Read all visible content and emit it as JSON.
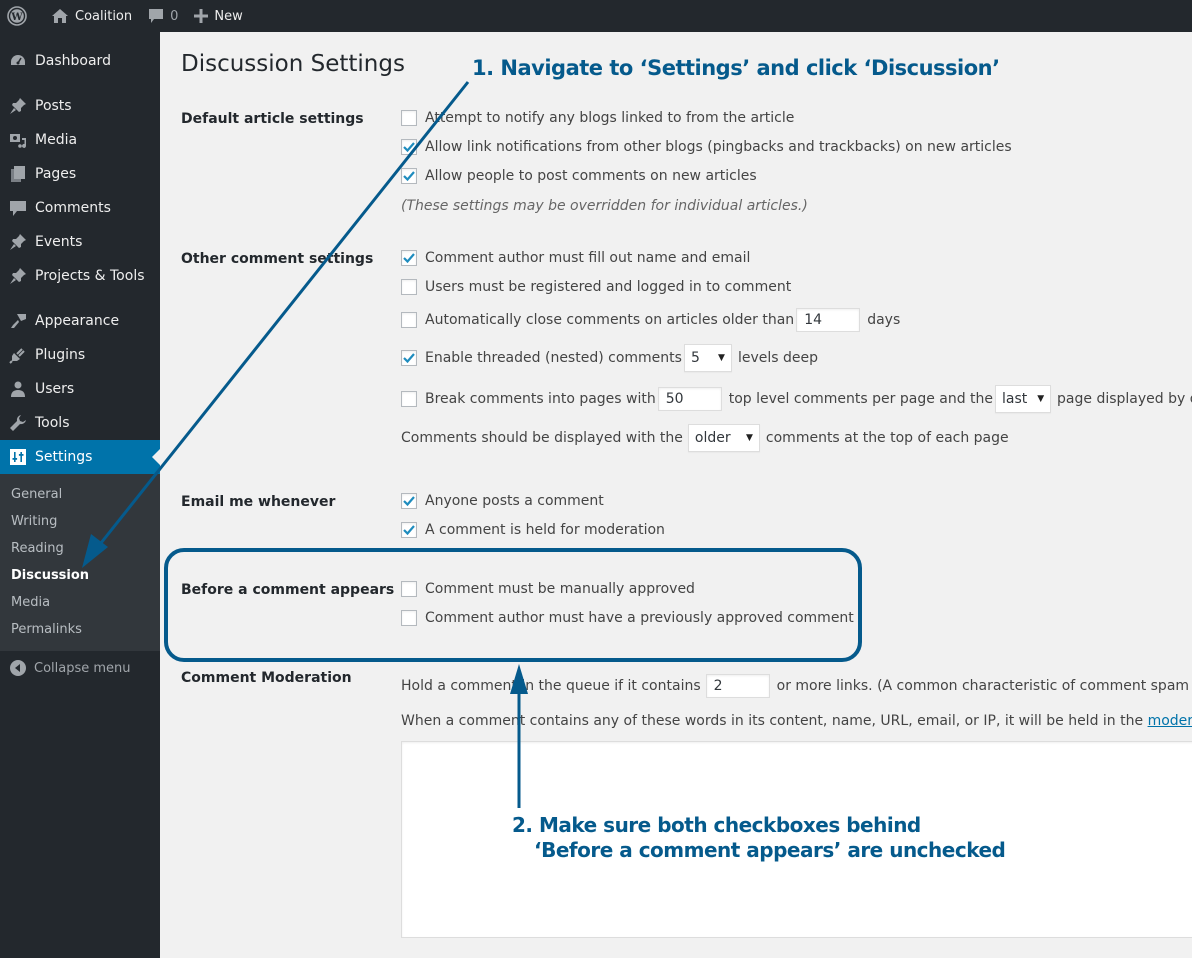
{
  "admin_bar": {
    "site_name": "Coalition",
    "comments_count": "0",
    "new_label": "New",
    "icons": [
      "wordpress-logo-icon",
      "home-icon",
      "comment-bubble-icon",
      "plus-icon"
    ]
  },
  "sidebar": {
    "items": [
      {
        "label": "Dashboard",
        "icon": "dashboard-gauge-icon"
      },
      {
        "label": "Posts",
        "icon": "pushpin-icon"
      },
      {
        "label": "Media",
        "icon": "media-camera-music-icon"
      },
      {
        "label": "Pages",
        "icon": "pages-icon"
      },
      {
        "label": "Comments",
        "icon": "comment-bubble-icon"
      },
      {
        "label": "Events",
        "icon": "pushpin-icon"
      },
      {
        "label": "Projects & Tools",
        "icon": "pushpin-icon"
      },
      {
        "label": "Appearance",
        "icon": "paintbrush-icon"
      },
      {
        "label": "Plugins",
        "icon": "plug-icon"
      },
      {
        "label": "Users",
        "icon": "user-icon"
      },
      {
        "label": "Tools",
        "icon": "wrench-icon"
      },
      {
        "label": "Settings",
        "icon": "sliders-icon",
        "current": true
      }
    ],
    "submenu": [
      {
        "label": "General"
      },
      {
        "label": "Writing"
      },
      {
        "label": "Reading"
      },
      {
        "label": "Discussion",
        "current": true
      },
      {
        "label": "Media"
      },
      {
        "label": "Permalinks"
      }
    ],
    "collapse_label": "Collapse menu"
  },
  "page": {
    "title": "Discussion Settings",
    "sections": {
      "default_article": {
        "label": "Default article settings",
        "options": [
          {
            "label": "Attempt to notify any blogs linked to from the article",
            "checked": false
          },
          {
            "label": "Allow link notifications from other blogs (pingbacks and trackbacks) on new articles",
            "checked": true
          },
          {
            "label": "Allow people to post comments on new articles",
            "checked": true
          }
        ],
        "note": "(These settings may be overridden for individual articles.)"
      },
      "other_comment": {
        "label": "Other comment settings",
        "require_name_email": {
          "label": "Comment author must fill out name and email",
          "checked": true
        },
        "registration": {
          "label": "Users must be registered and logged in to comment",
          "checked": false
        },
        "auto_close": {
          "label_before": "Automatically close comments on articles older than",
          "value": "14",
          "label_after": "days",
          "checked": false
        },
        "threaded": {
          "label_before": "Enable threaded (nested) comments",
          "value": "5",
          "label_after": "levels deep",
          "checked": true
        },
        "paging": {
          "label_before": "Break comments into pages with",
          "per_page": "50",
          "label_middle": "top level comments per page and the",
          "default_page": "last",
          "label_after": "page displayed by default",
          "checked": false
        },
        "order": {
          "label_before": "Comments should be displayed with the",
          "value": "older",
          "label_after": "comments at the top of each page"
        }
      },
      "email": {
        "label": "Email me whenever",
        "options": [
          {
            "label": "Anyone posts a comment",
            "checked": true
          },
          {
            "label": "A comment is held for moderation",
            "checked": true
          }
        ]
      },
      "before_appears": {
        "label": "Before a comment appears",
        "options": [
          {
            "label": "Comment must be manually approved",
            "checked": false
          },
          {
            "label": "Comment author must have a previously approved comment",
            "checked": false
          }
        ]
      },
      "moderation": {
        "label": "Comment Moderation",
        "hold_before": "Hold a comment in the queue if it contains",
        "links_value": "2",
        "hold_after": "or more links. (A common characteristic of comment spam is a large",
        "words_text": "When a comment contains any of these words in its content, name, URL, email, or IP, it will be held in the",
        "words_link": "moderation queue",
        "keys_value": ""
      }
    }
  },
  "annotations": {
    "step1": "1. Navigate to ‘Settings’ and click ‘Discussion’",
    "step2_line1": "2. Make sure both checkboxes behind",
    "step2_line2": "‘Before a comment appears’ are unchecked",
    "color": "#055a8c"
  }
}
